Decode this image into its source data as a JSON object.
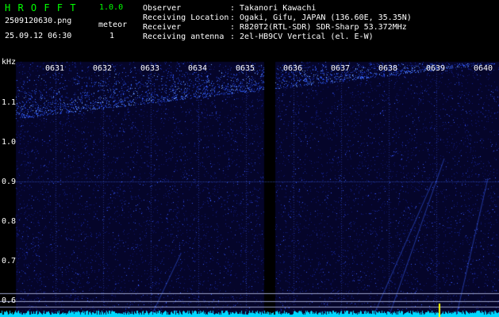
{
  "app": {
    "title": "H R O F F T",
    "version": "1.0.0",
    "filename": "2509120630.png",
    "datetime": "25.09.12 06:30",
    "meteor_label": "meteor",
    "meteor_count": "1"
  },
  "info": {
    "rows": [
      {
        "key": "Observer",
        "value": ": Takanori Kawachi"
      },
      {
        "key": "Receiving Location",
        "value": ": Ogaki, Gifu, JAPAN (136.60E, 35.35N)"
      },
      {
        "key": "Receiver",
        "value": ": R820T2(RTL-SDR) SDR-Sharp 53.372MHz"
      },
      {
        "key": "Receiving antenna",
        "value": ": 2el-HB9CV Vertical (el. E-W)"
      }
    ]
  },
  "spectrogram": {
    "y_unit": "kHz",
    "y_labels": [
      "1.1",
      "1.0",
      "0.9",
      "0.8",
      "0.7",
      "0.6"
    ],
    "time_labels": [
      "0631",
      "0632",
      "0633",
      "0634",
      "0635",
      "0636",
      "0637",
      "0638",
      "0639",
      "0640"
    ]
  },
  "colors": {
    "title": "#00ff00",
    "info": "#ffffff",
    "background": "#000000",
    "noise": "#0a0a3a",
    "signal": "#4a7cff",
    "baseline": "#00e5ff",
    "marker": "#ffff00"
  }
}
